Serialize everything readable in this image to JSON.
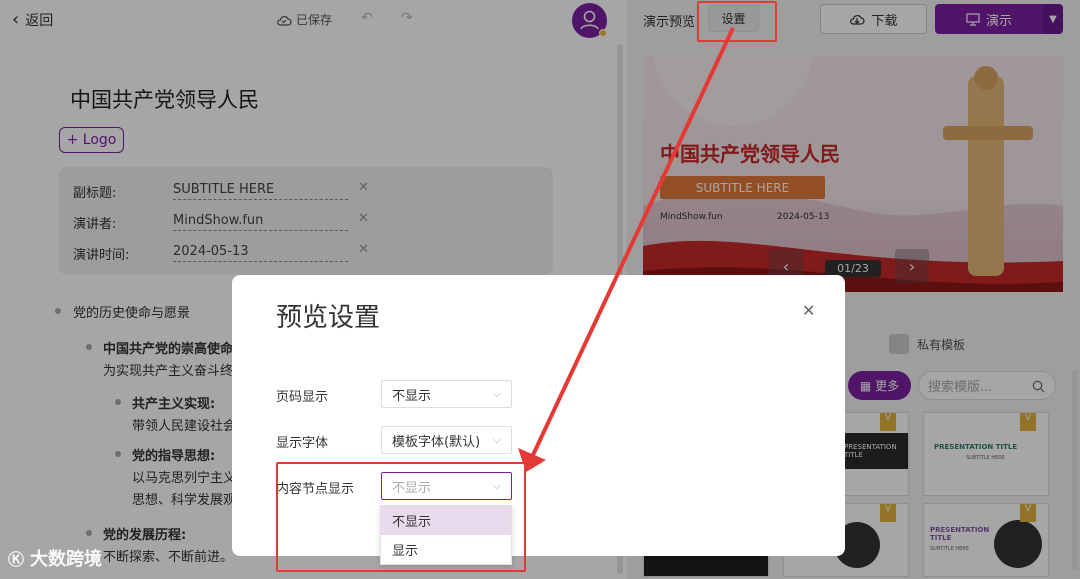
{
  "editor": {
    "back_label": "返回",
    "saved_label": "已保存",
    "title": "中国共产党领导人民",
    "logo_button": "+ Logo",
    "meta": [
      {
        "label": "副标题:",
        "value": "SUBTITLE HERE"
      },
      {
        "label": "演讲者:",
        "value": "MindShow.fun"
      },
      {
        "label": "演讲时间:",
        "value": "2024-05-13"
      }
    ],
    "outline": [
      {
        "text": "党的历史使命与愿景"
      },
      {
        "text": "中国共产党的崇高使命"
      },
      {
        "text": "为实现共产主义奋斗终"
      },
      {
        "text": "共产主义实现:"
      },
      {
        "text": "带领人民建设社会"
      },
      {
        "text": "党的指导思想:"
      },
      {
        "text": "以马克思列宁主义"
      },
      {
        "text": "思想、科学发展观"
      },
      {
        "text": "党的发展历程:"
      },
      {
        "text": "不断探索、不断前进。"
      }
    ]
  },
  "preview": {
    "label": "演示预览",
    "settings_button": "设置",
    "download_button": "下载",
    "present_button": "演示",
    "slide": {
      "title": "中国共产党领导人民",
      "subtitle": "SUBTITLE HERE",
      "author": "MindShow.fun",
      "date": "2024-05-13",
      "counter": "01/23"
    }
  },
  "templates": {
    "private_tab": "私有模板",
    "more_button": "更多",
    "search_placeholder": "搜索模版...",
    "thumbs": [
      {
        "badge": "V",
        "title": "PRESENTATION TITLE"
      },
      {
        "badge": "V",
        "title": "PRESENTATION TITLE",
        "sub": "SUBTITLE HERE"
      },
      {
        "badge": "V",
        "title": ""
      },
      {
        "badge": "V",
        "title": "PRESENTATION TITLE",
        "sub": "SUBTITLE HERE"
      }
    ]
  },
  "modal": {
    "title": "预览设置",
    "fields": [
      {
        "label": "页码显示",
        "value": "不显示"
      },
      {
        "label": "显示字体",
        "value": "模板字体(默认)"
      },
      {
        "label": "内容节点显示",
        "value": "不显示"
      }
    ],
    "dropdown_options": [
      "不显示",
      "显示"
    ]
  },
  "watermark": {
    "text": "大数跨境"
  },
  "colors": {
    "accent": "#7b1fa2",
    "highlight": "#e53935"
  }
}
